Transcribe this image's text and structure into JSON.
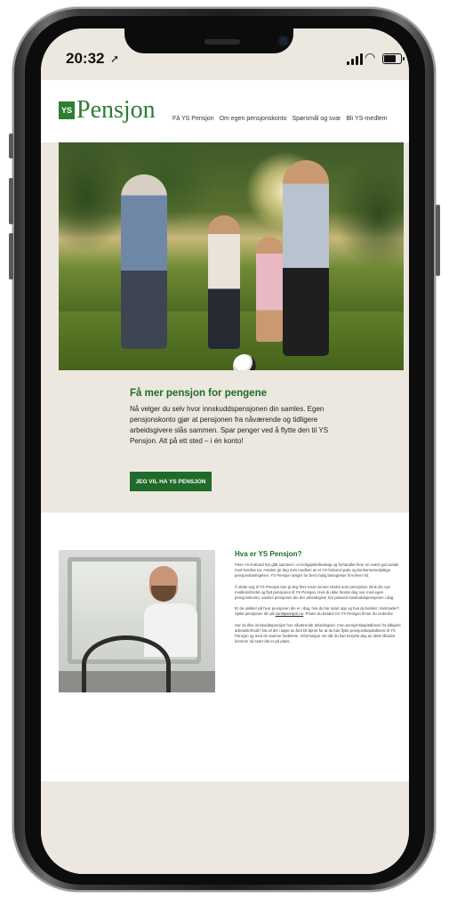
{
  "status_bar": {
    "time": "20:32",
    "location_glyph": "➚",
    "wifi_glyph": "◠",
    "battery_level": 0.75
  },
  "header": {
    "logo_mark": "YS",
    "logo_text": "Pensjon",
    "nav": [
      "Få YS Pensjon",
      "Om egen pensjonskonto",
      "Spørsmål og svar",
      "Bli YS-medlem"
    ]
  },
  "promo": {
    "title": "Få mer pensjon for pengene",
    "text": "Nå velger du selv hvor innskuddspensjonen din samles. Egen pensjonskonto gjør at pensjonen fra nåværende og tidligere arbeidsgivere slås sammen. Spar penger ved å flytte den til YS Pensjon. Alt på ett sted – i én konto!",
    "cta_label": "JEG VIL HA YS PENSJON"
  },
  "info": {
    "title": "Hva er YS Pensjon?",
    "p1": "Flere YS-forbund har gått sammen i et innkjøpsfellesskap og forhandlet frem en svært god avtale med Nordea Liv. Avtalen gir deg som medlem av et YS-forbund gode og konkurransedyktige pensjonsbetingelser. YS Pensjon sørger for best mulig betingelser til enhver tid.",
    "p2": "Å slutte seg til YS Pensjon kan gi deg flere tusen kroner ekstra som pensjonist. Bruk din nye medlemsfordel og flytt pensjonen til YS Pensjon. Hvis du ikke foretar deg noe med egen pensjonskonto, samles pensjonen din der arbeidsgiver har plassert innskuddspensjonen i dag.",
    "p3_before": "Er du usikker på hvor pensjonen din er i dag, hva du har spart opp og hva du betaler i kostnader? Sjekk pensjonen din på ",
    "p3_link": "norskpensjon.no",
    "p3_after": ". Prisen du betaler for YS Pensjon finner du nedenfor.",
    "p4": "Har du ikke innskuddspensjon hos nåværende arbeidsgiver, men pensjonskapitalbevis fra tidligere arbeidsforhold? Da vil det i løpet av året bli åpnet for at du kan flytte pensjonskapitalbevis til YS Pensjon og med de samme fordelene. Informasjon om når du kan benytte deg av dette tilbudet kommer så snart det er på plass."
  }
}
